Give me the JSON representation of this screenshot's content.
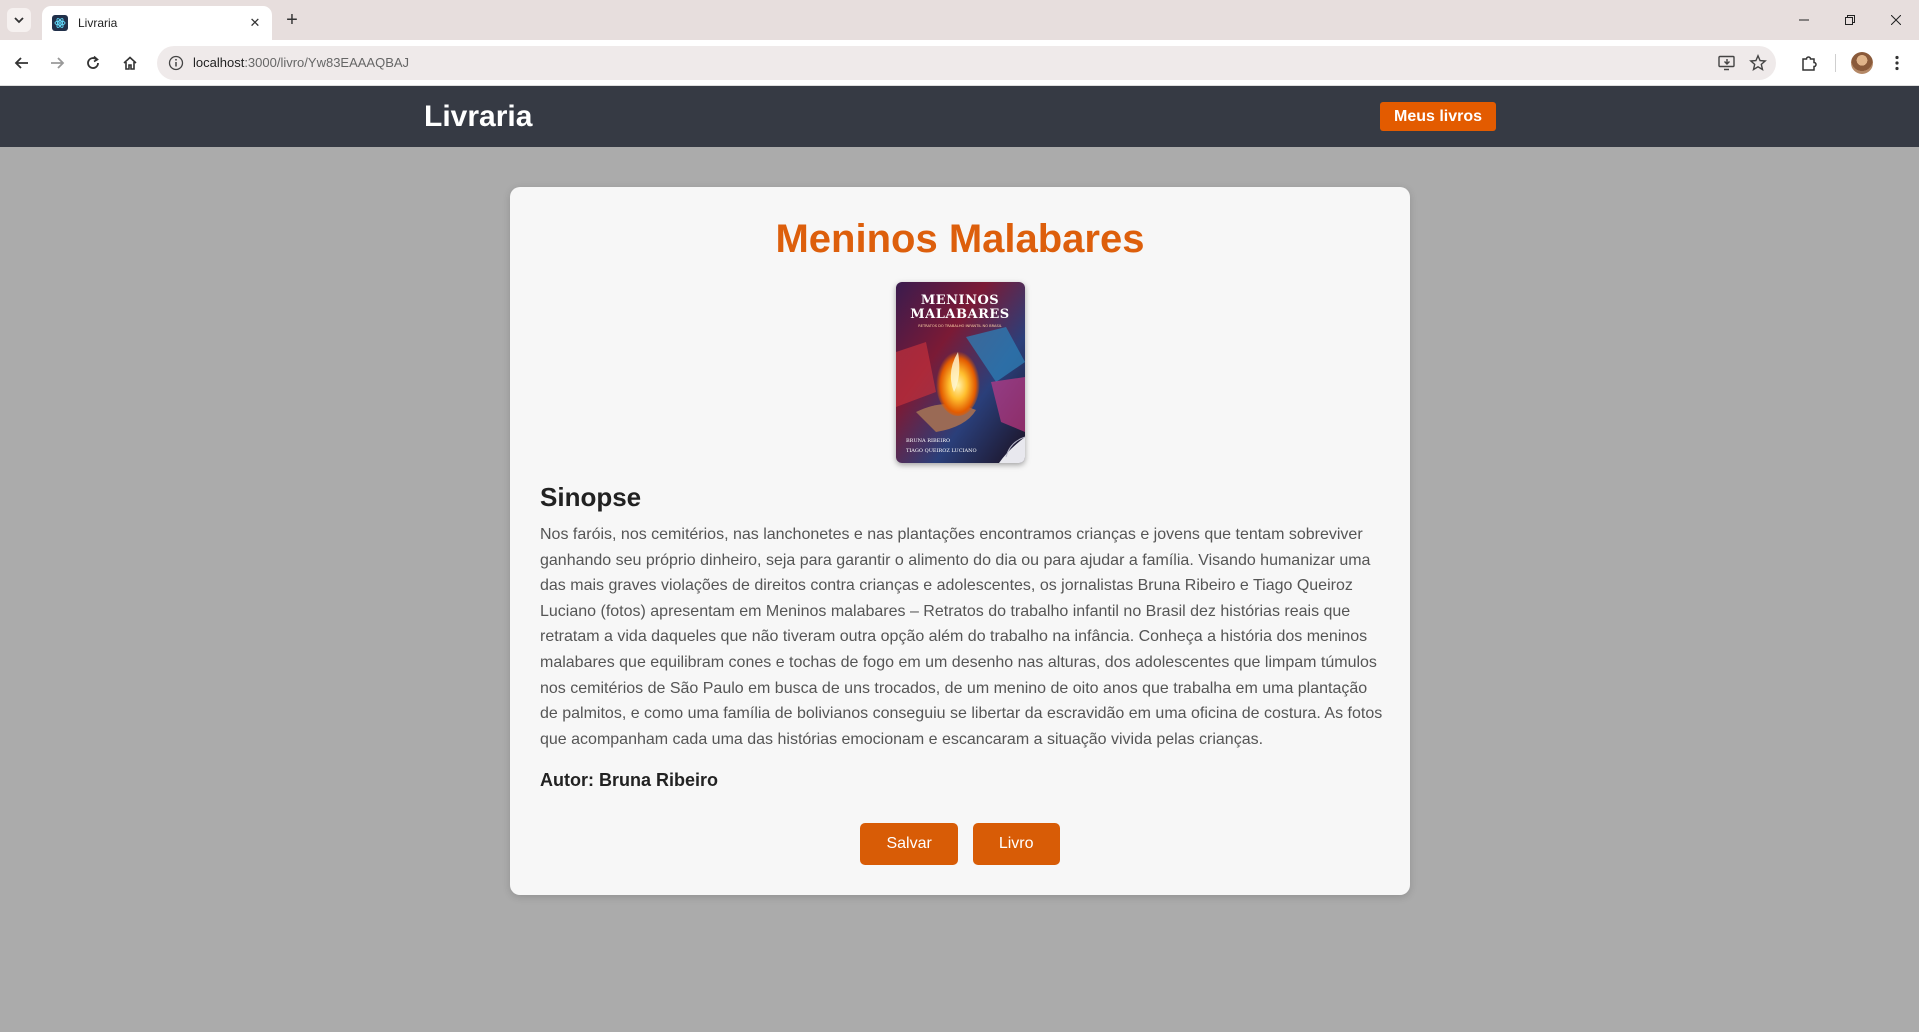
{
  "browser": {
    "tab_title": "Livraria",
    "url_host": "localhost",
    "url_path": ":3000/livro/Yw83EAAAQBAJ"
  },
  "header": {
    "brand": "Livraria",
    "meus_livros_label": "Meus livros"
  },
  "book": {
    "title": "Meninos Malabares",
    "cover_alt": "Capa do livro Meninos Malabares",
    "cover_text": {
      "line1": "MENINOS",
      "line2": "MALABARES",
      "subtitle": "RETRATOS DO TRABALHO INFANTIL NO BRASIL",
      "author1": "BRUNA RIBEIRO",
      "author2": "TIAGO QUEIROZ LUCIANO"
    },
    "sinopse_heading": "Sinopse",
    "sinopse": "Nos faróis, nos cemitérios, nas lanchonetes e nas plantações encontramos crianças e jovens que tentam sobreviver ganhando seu próprio dinheiro, seja para garantir o alimento do dia ou para ajudar a família. Visando humanizar uma das mais graves violações de direitos contra crianças e adolescentes, os jornalistas Bruna Ribeiro e Tiago Queiroz Luciano (fotos) apresentam em Meninos malabares – Retratos do trabalho infantil no Brasil dez histórias reais que retratam a vida daqueles que não tiveram outra opção além do trabalho na infância. Conheça a história dos meninos malabares que equilibram cones e tochas de fogo em um desenho nas alturas, dos adolescentes que limpam túmulos nos cemitérios de São Paulo em busca de uns trocados, de um menino de oito anos que trabalha em uma plantação de palmitos, e como uma família de bolivianos conseguiu se libertar da escravidão em uma oficina de costura. As fotos que acompanham cada uma das histórias emocionam e escancaram a situação vivida pelas crianças.",
    "autor_label": "Autor:",
    "autor_name": "Bruna Ribeiro"
  },
  "actions": {
    "salvar_label": "Salvar",
    "livro_label": "Livro"
  },
  "colors": {
    "accent": "#dd5f0c",
    "header_bg": "#363a44",
    "page_bg": "#ababab",
    "card_bg": "#f7f7f7"
  }
}
